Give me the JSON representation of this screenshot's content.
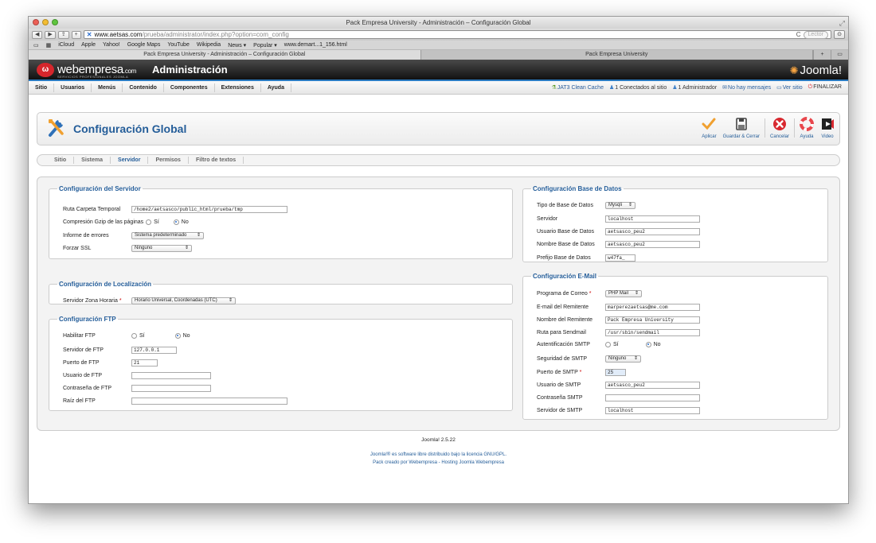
{
  "browser": {
    "window_title": "Pack Empresa University - Administración – Configuración Global",
    "url_domain": "www.aetsas.com",
    "url_path": "/prueba/administrator/index.php?option=com_config",
    "reader_label": "Lector",
    "bookmarks": [
      "iCloud",
      "Apple",
      "Yahoo!",
      "Google Maps",
      "YouTube",
      "Wikipedia",
      "News ▾",
      "Popular ▾",
      "www.demart...1_156.html"
    ],
    "tabs": [
      {
        "label": "Pack Empresa University - Administración – Configuración Global",
        "active": true
      },
      {
        "label": "Pack Empresa University",
        "active": false
      }
    ]
  },
  "header": {
    "brand": "webempresa",
    "brand_suffix": ".com",
    "brand_tagline": "SERVICIOS PROFESIONALES JOOMLA",
    "title": "Administración",
    "joomla_logo": "Joomla!"
  },
  "menu": {
    "items": [
      "Sitio",
      "Usuarios",
      "Menús",
      "Contenido",
      "Componentes",
      "Extensiones",
      "Ayuda"
    ],
    "status": {
      "cache": "JAT3 Clean Cache",
      "connected": "1 Conectados al sitio",
      "admins": "1 Administrador",
      "messages": "No hay mensajes",
      "view_site": "Ver sitio",
      "logout": "FINALIZAR"
    }
  },
  "toolbar": {
    "title": "Configuración Global",
    "apply": "Aplicar",
    "save_close": "Guardar & Cerrar",
    "cancel": "Cancelar",
    "help": "Ayuda",
    "video": "Video"
  },
  "subtabs": [
    "Sitio",
    "Sistema",
    "Servidor",
    "Permisos",
    "Filtro de textos"
  ],
  "server": {
    "legend": "Configuración del Servidor",
    "tmp_label": "Ruta Carpeta Temporal",
    "tmp_value": "/home2/aetsasco/public_html/prueba/tmp",
    "gzip_label": "Compresión Gzip de las páginas",
    "yes": "Sí",
    "no": "No",
    "errors_label": "Informe de errores",
    "errors_value": "Sistema predeterminado",
    "ssl_label": "Forzar SSL",
    "ssl_value": "Ninguno"
  },
  "locale": {
    "legend": "Configuración de Localización",
    "tz_label": "Servidor Zona Horaria",
    "tz_value": "Horario Universal, Coordenadas (UTC)"
  },
  "ftp": {
    "legend": "Configuración FTP",
    "enable_label": "Habilitar FTP",
    "host_label": "Servidor de FTP",
    "host_value": "127.0.0.1",
    "port_label": "Puerto de FTP",
    "port_value": "21",
    "user_label": "Usuario de FTP",
    "user_value": "",
    "pass_label": "Contraseña de FTP",
    "pass_value": "",
    "root_label": "Raíz del FTP",
    "root_value": ""
  },
  "db": {
    "legend": "Configuración Base de Datos",
    "type_label": "Tipo de Base de Datos",
    "type_value": "Mysqli",
    "host_label": "Servidor",
    "host_value": "localhost",
    "user_label": "Usuario Base de Datos",
    "user_value": "aetsasco_peu2",
    "name_label": "Nombre Base de Datos",
    "name_value": "aetsasco_peu2",
    "prefix_label": "Prefijo Base de Datos",
    "prefix_value": "w47fa_"
  },
  "mail": {
    "legend": "Configuración E-Mail",
    "mailer_label": "Programa de Correo",
    "mailer_value": "PHP Mail",
    "from_label": "E-mail del Remitente",
    "from_value": "marperezaetsas@me.com",
    "fromname_label": "Nombre del Remitente",
    "fromname_value": "Pack Empresa University",
    "sendmail_label": "Ruta para Sendmail",
    "sendmail_value": "/usr/sbin/sendmail",
    "smtpauth_label": "Autentificación SMTP",
    "smtpsecure_label": "Seguridad de SMTP",
    "smtpsecure_value": "Ninguno",
    "smtpport_label": "Puerto de SMTP",
    "smtpport_value": "25",
    "smtpuser_label": "Usuario de SMTP",
    "smtpuser_value": "aetsasco_peu2",
    "smtppass_label": "Contraseña SMTP",
    "smtppass_value": "",
    "smtphost_label": "Servidor de SMTP",
    "smtphost_value": "localhost"
  },
  "footer": {
    "version": "Joomla! 2.5.22",
    "license": "Joomla!® es software libre distribuido bajo la licencia GNU/GPL.",
    "credit": "Pack creado por Webempresa - Hosting Joomla Webempresa"
  },
  "colors": {
    "accent_blue": "#245d99",
    "header_stripe": "#2b7bc1",
    "brand_red": "#d6262c"
  }
}
